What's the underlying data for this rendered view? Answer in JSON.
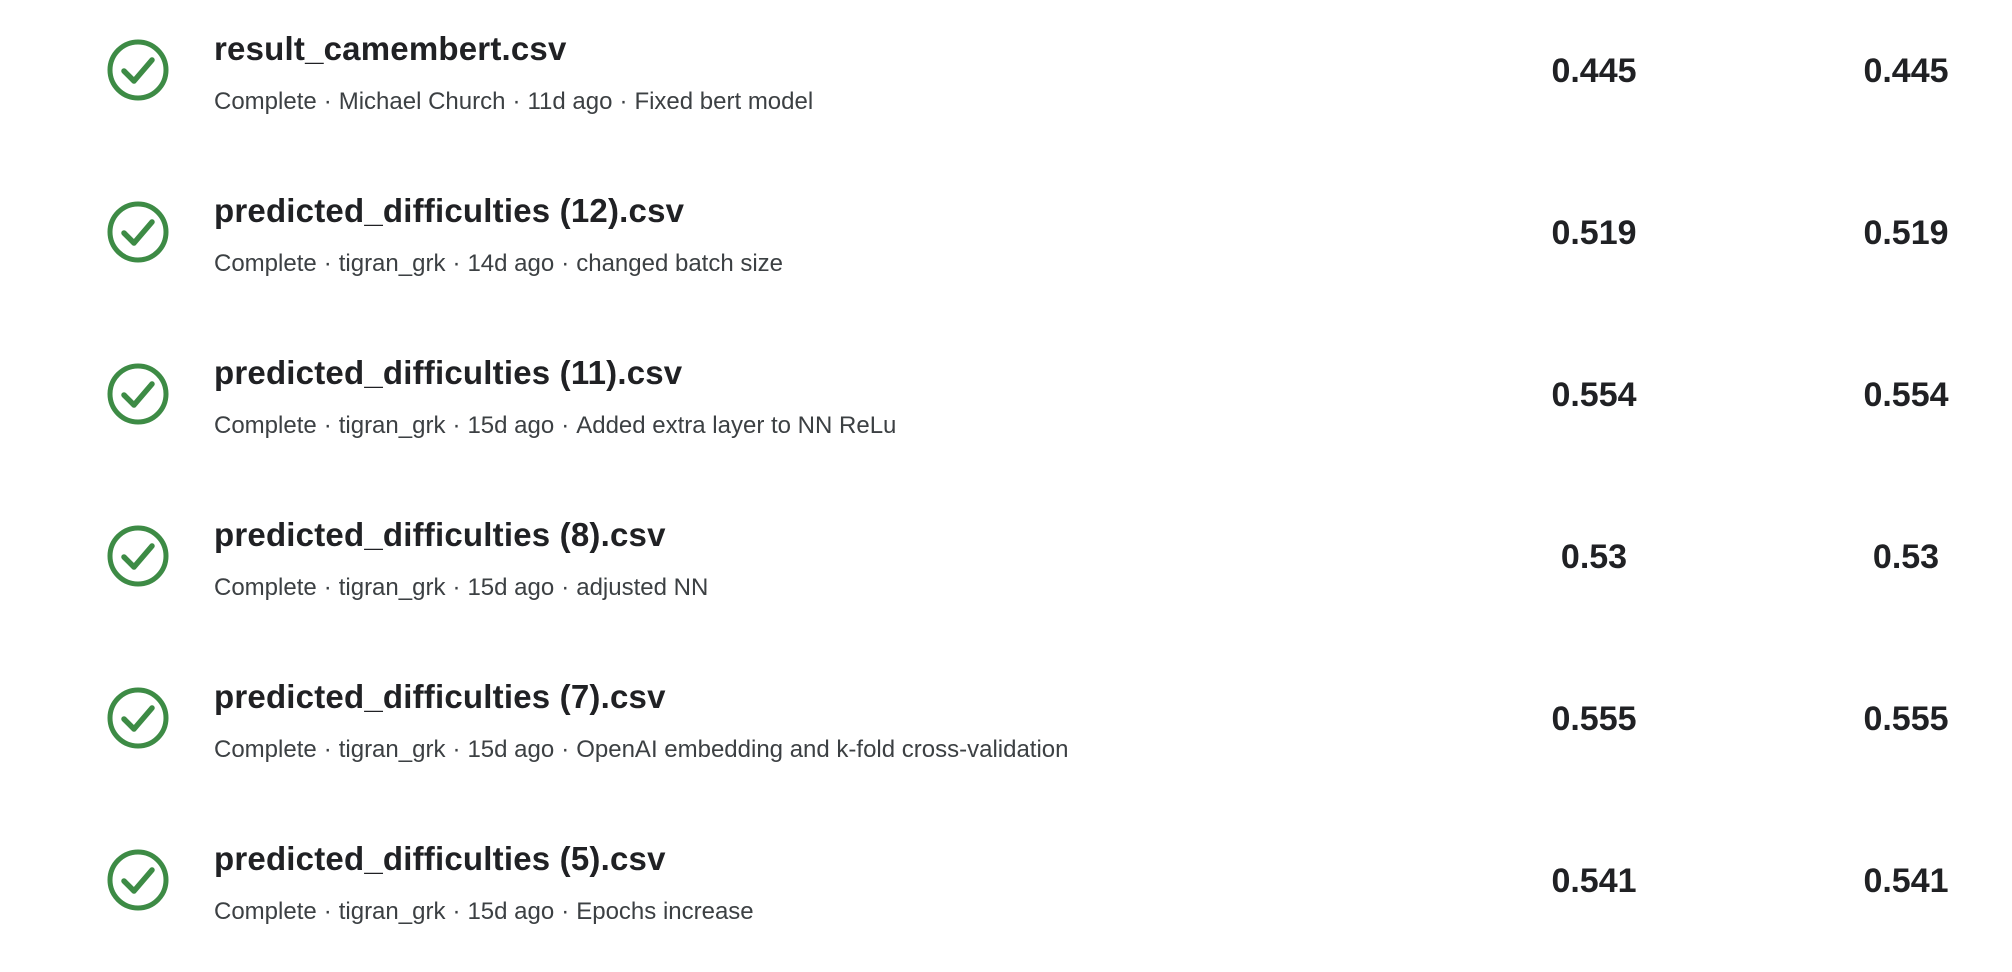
{
  "colors": {
    "status_complete": "#3d8b45",
    "text_primary": "#202124",
    "text_secondary": "#3c4043"
  },
  "submissions": [
    {
      "file_name": "result_camembert.csv",
      "status": "Complete",
      "author": "Michael Church",
      "age": "11d ago",
      "description": "Fixed bert model",
      "private_score": "0.445",
      "public_score": "0.445",
      "icon": "check-circle-icon"
    },
    {
      "file_name": "predicted_difficulties (12).csv",
      "status": "Complete",
      "author": "tigran_grk",
      "age": "14d ago",
      "description": "changed batch size",
      "private_score": "0.519",
      "public_score": "0.519",
      "icon": "check-circle-icon"
    },
    {
      "file_name": "predicted_difficulties (11).csv",
      "status": "Complete",
      "author": "tigran_grk",
      "age": "15d ago",
      "description": "Added extra layer to NN ReLu",
      "private_score": "0.554",
      "public_score": "0.554",
      "icon": "check-circle-icon"
    },
    {
      "file_name": "predicted_difficulties (8).csv",
      "status": "Complete",
      "author": "tigran_grk",
      "age": "15d ago",
      "description": "adjusted NN",
      "private_score": "0.53",
      "public_score": "0.53",
      "icon": "check-circle-icon"
    },
    {
      "file_name": "predicted_difficulties (7).csv",
      "status": "Complete",
      "author": "tigran_grk",
      "age": "15d ago",
      "description": "OpenAI embedding and k-fold cross-validation",
      "private_score": "0.555",
      "public_score": "0.555",
      "icon": "check-circle-icon"
    },
    {
      "file_name": "predicted_difficulties (5).csv",
      "status": "Complete",
      "author": "tigran_grk",
      "age": "15d ago",
      "description": "Epochs increase",
      "private_score": "0.541",
      "public_score": "0.541",
      "icon": "check-circle-icon"
    }
  ]
}
